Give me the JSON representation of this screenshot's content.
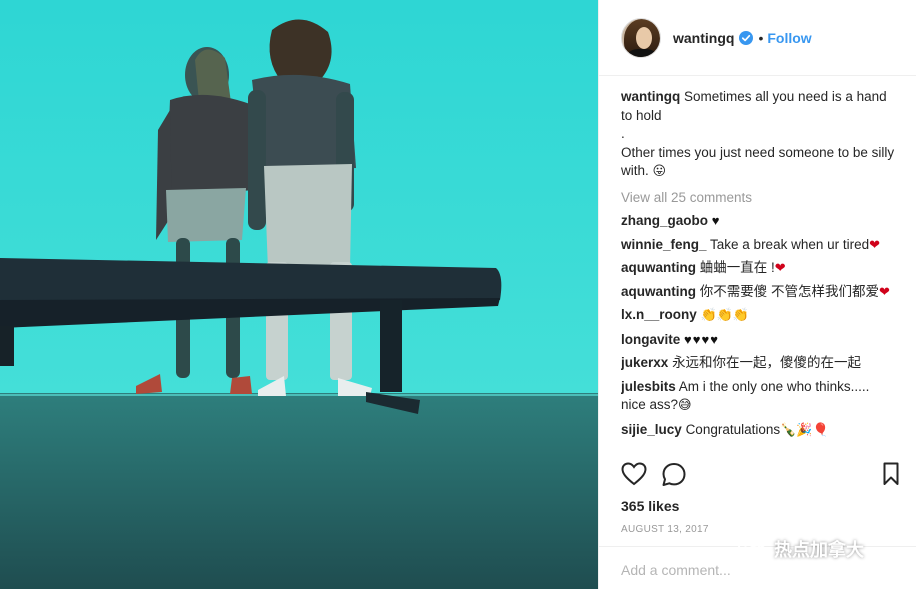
{
  "post": {
    "username": "wantingq",
    "follow_label": "Follow",
    "caption_user": "wantingq",
    "caption_line1": "Sometimes all you need is a hand to hold",
    "caption_dot": ".",
    "caption_line2": "Other times you just need someone to be silly with.",
    "view_all": "View all 25 comments",
    "likes": "365 likes",
    "date": "AUGUST 13, 2017",
    "add_comment_placeholder": "Add a comment..."
  },
  "comments": [
    {
      "user": "zhang_gaobo",
      "text": "",
      "emoji": "♥",
      "emoji_style": "black"
    },
    {
      "user": "winnie_feng_",
      "text": "Take a break when ur tired",
      "emoji": "❤",
      "emoji_style": "red"
    },
    {
      "user": "aquwanting",
      "text": "蛐蛐一直在 !",
      "emoji": "❤",
      "emoji_style": "red"
    },
    {
      "user": "aquwanting",
      "text": "你不需要傻 不管怎样我们都爱",
      "emoji": "❤",
      "emoji_style": "red"
    },
    {
      "user": "lx.n__roony",
      "text": "",
      "emoji": "👏👏👏",
      "emoji_style": "emoji"
    },
    {
      "user": "longavite",
      "text": "",
      "emoji": "♥♥♥♥",
      "emoji_style": "black"
    },
    {
      "user": "jukerxx",
      "text": "永远和你在一起，傻傻的在一起",
      "emoji": "",
      "emoji_style": ""
    },
    {
      "user": "julesbits",
      "text": "Am i the only one who thinks..... nice ass?",
      "emoji": "😅",
      "emoji_style": "emoji"
    },
    {
      "user": "sijie_lucy",
      "text": "Congratulations",
      "emoji": "🍾🎉🎈",
      "emoji_style": "emoji"
    }
  ],
  "caption_emoji": "😛",
  "icons": [
    "heart-icon",
    "comment-icon",
    "bookmark-icon",
    "verified-badge-icon"
  ],
  "watermark": {
    "text": "热点加拿大"
  },
  "colors": {
    "accent": "#3897f0",
    "water": "#35dbd8",
    "muted": "#999999"
  }
}
